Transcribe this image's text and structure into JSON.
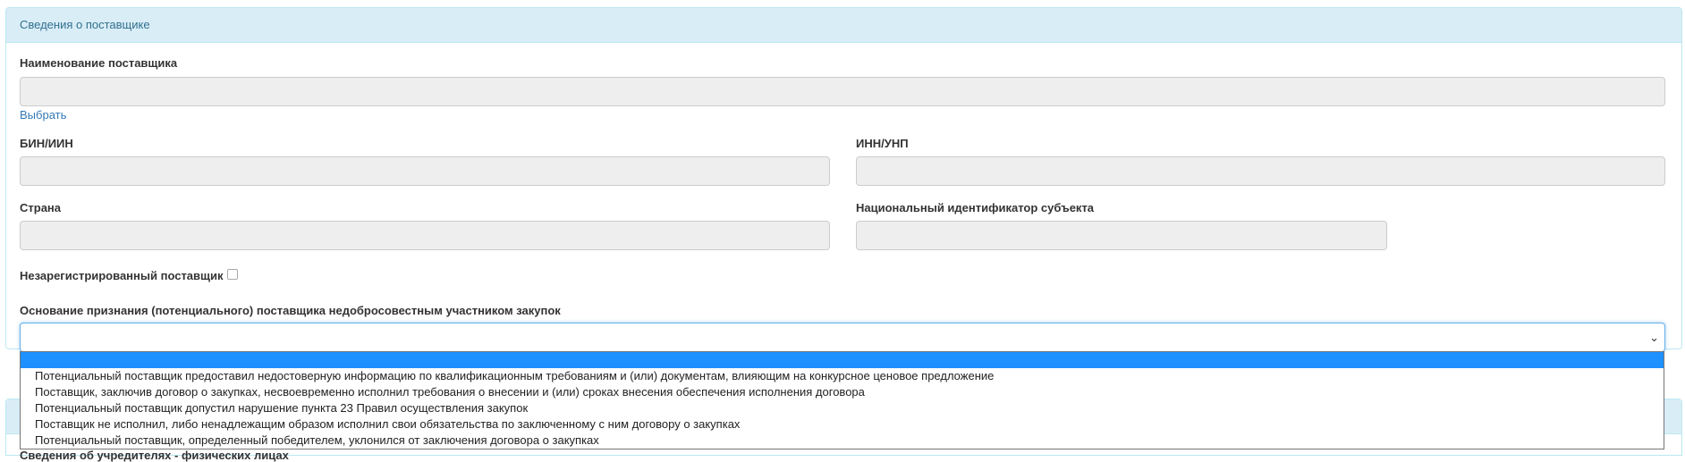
{
  "panel": {
    "heading": "Сведения о поставщике",
    "supplier_name_label": "Наименование поставщика",
    "choose_link": "Выбрать",
    "bin_label": "БИН/ИИН",
    "inn_label": "ИНН/УНП",
    "country_label": "Страна",
    "national_id_label": "Национальный идентификатор субъекта",
    "unregistered_label": "Незарегистрированный поставщик",
    "basis_label": "Основание признания (потенциального) поставщика недобросовестным участником закупок",
    "basis_selected": ""
  },
  "dropdown": {
    "options": [
      "Потенциальный поставщик предоставил недостоверную информацию по квалификационным требованиям и (или) документам, влияющим на конкурсное ценовое предложение",
      "Поставщик, заключив договор о закупках, несвоевременно исполнил требования о внесении и (или) сроках внесения обеспечения исполнения договора",
      "Потенциальный поставщик допустил нарушение пункта 23 Правил осуществления закупок",
      "Поставщик не исполнил, либо ненадлежащим образом исполнил свои обязательства по заключенному с ним договору о закупках",
      "Потенциальный поставщик, определенный победителем, уклонился от заключения договора о закупках"
    ]
  },
  "panel2": {
    "partial_label": "Сведения об учредителях - физических лицах"
  },
  "icons": {
    "dropdown_chevron": "chevron-down-icon"
  },
  "colors": {
    "heading_bg": "#d9edf7",
    "heading_text": "#31708f",
    "link": "#337ab7",
    "selected_option": "#1e90ff"
  }
}
